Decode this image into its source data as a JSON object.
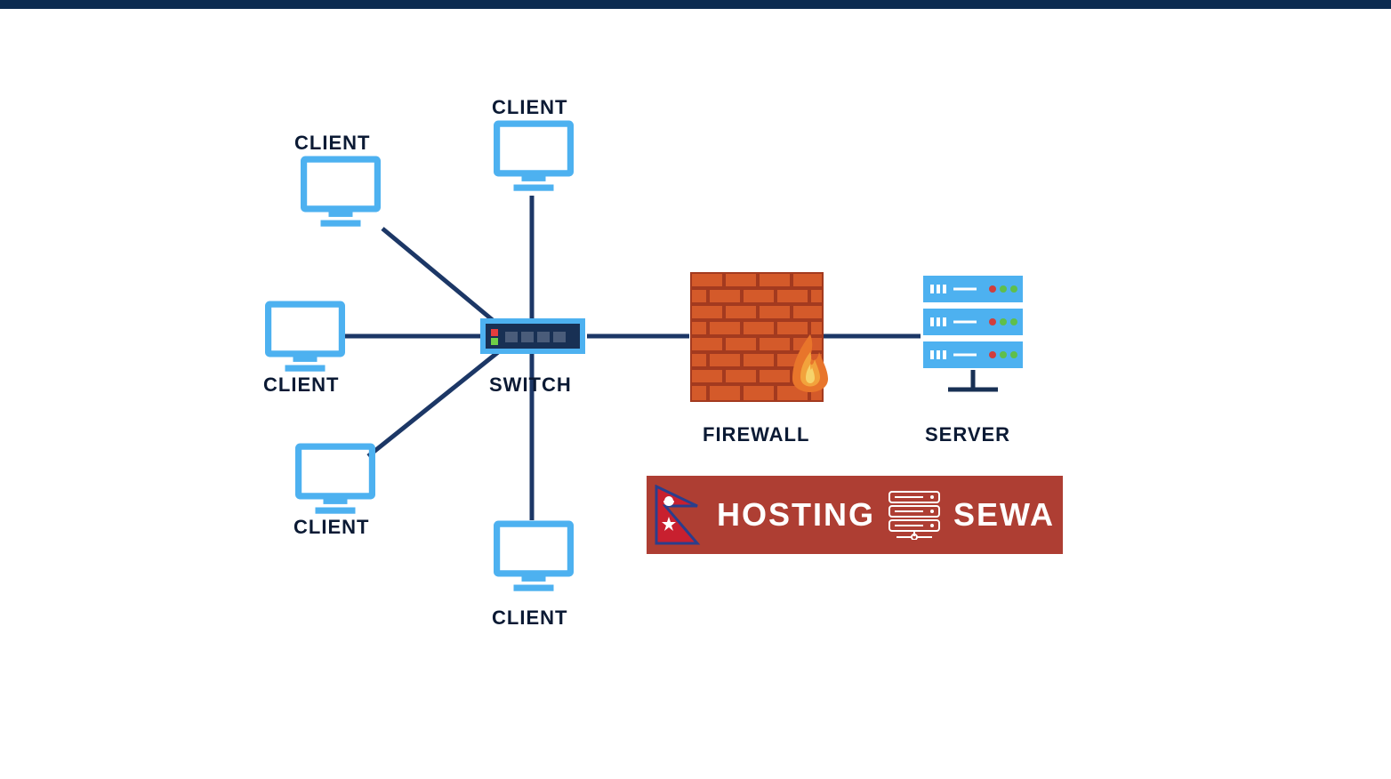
{
  "nodes": {
    "client1": {
      "label": "CLIENT"
    },
    "client2": {
      "label": "CLIENT"
    },
    "client3": {
      "label": "CLIENT"
    },
    "client4": {
      "label": "CLIENT"
    },
    "client5": {
      "label": "CLIENT"
    },
    "switch": {
      "label": "SWITCH"
    },
    "firewall": {
      "label": "FIREWALL"
    },
    "server": {
      "label": "SERVER"
    }
  },
  "logo": {
    "text1": "HOSTING",
    "text2": "SEWA"
  },
  "colors": {
    "dark_navy": "#0b1a34",
    "line": "#1c3766",
    "client_blue": "#4db1f0",
    "banner": "#ae3e33",
    "brick": "#d45a2a",
    "brick_dark": "#a33a1f",
    "switch_case": "#4db1f0",
    "switch_body": "#183054",
    "server_body": "#4db1f0"
  }
}
